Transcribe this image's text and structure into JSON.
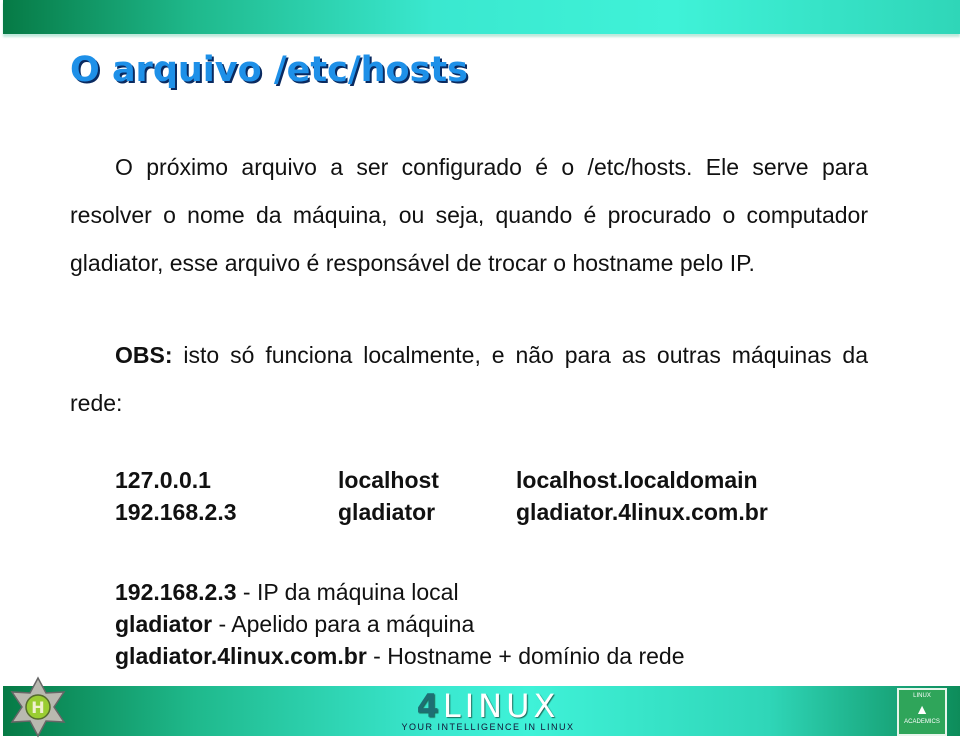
{
  "slide": {
    "title": "O arquivo /etc/hosts",
    "paragraph1": "O próximo arquivo a ser configurado é o /etc/hosts. Ele serve para resolver o nome da máquina, ou seja, quando é procurado o computador gladiator, esse arquivo é responsável de trocar o hostname pelo IP.",
    "obs_label": "OBS:",
    "obs_text": " isto só funciona localmente, e não para as outras máquinas da rede:",
    "hosts_rows": [
      {
        "ip": "127.0.0.1",
        "name": "localhost",
        "fqdn": "localhost.localdomain"
      },
      {
        "ip": "192.168.2.3",
        "name": "gladiator",
        "fqdn": "gladiator.4linux.com.br"
      }
    ],
    "legend": [
      {
        "term": "192.168.2.3",
        "desc": " - IP da máquina local"
      },
      {
        "term": "gladiator",
        "desc": " - Apelido para a máquina"
      },
      {
        "term": "gladiator.4linux.com.br",
        "desc": " - Hostname + domínio da rede"
      }
    ]
  },
  "footer": {
    "brand_prefix": "4",
    "brand_name": "LINUX",
    "tagline": "YOUR INTELLIGENCE IN LINUX",
    "badge_top": "LINUX",
    "badge_bottom": "ACADEMICS",
    "badge_letter": "H",
    "colors": {
      "bar_dark": "#067a45",
      "bar_light": "#3ff2d8",
      "title": "#1e90e8"
    }
  }
}
